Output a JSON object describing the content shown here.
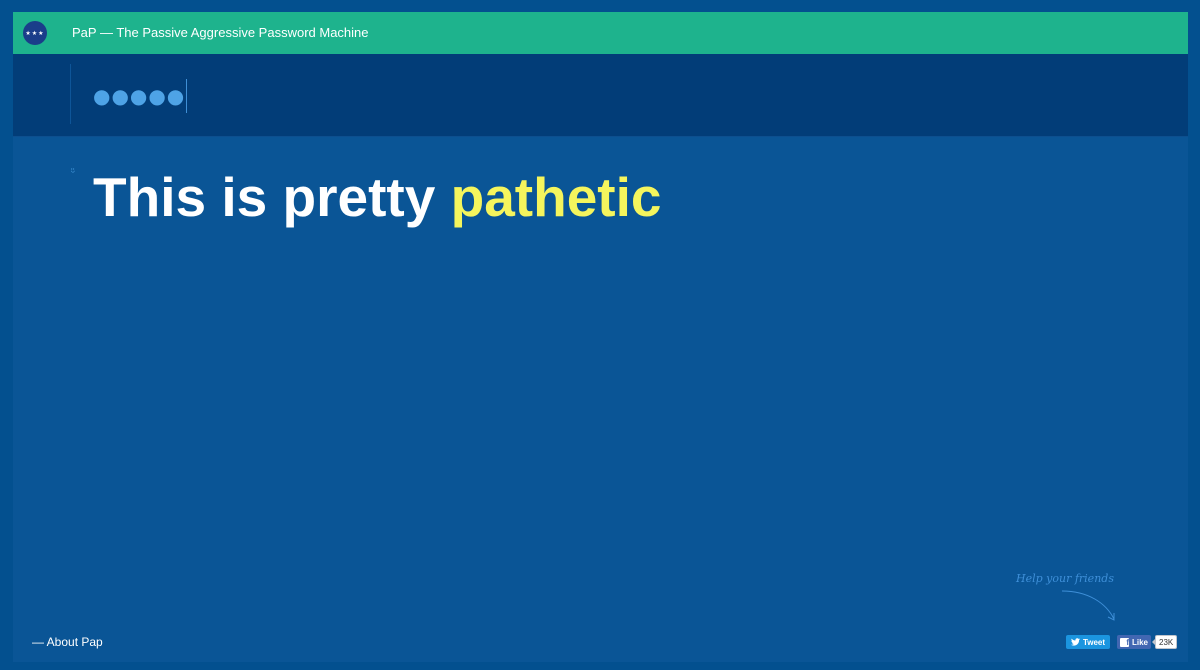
{
  "header": {
    "logo_glyph": "★★★",
    "title": "PaP — The Passive Aggressive Password Machine"
  },
  "password": {
    "value": "●●●●●",
    "placeholder": ""
  },
  "feedback": {
    "smiley": "ᵕ̈",
    "prefix": "This is pretty ",
    "highlight": "pathetic"
  },
  "footer": {
    "about_link": "— About Pap",
    "help_text": "Help your friends",
    "tweet_label": "Tweet",
    "like_label": "Like",
    "like_count": "23K"
  },
  "colors": {
    "background": "#0a5596",
    "topbar": "#1eb38d",
    "password_bar": "#023d78",
    "highlight": "#f5f55d",
    "twitter": "#1b95e0",
    "facebook": "#4267b2"
  },
  "icons": {
    "logo": "stars-logo-icon",
    "tweet": "twitter-bird-icon",
    "like": "facebook-f-icon",
    "arrow": "curved-arrow-icon"
  }
}
